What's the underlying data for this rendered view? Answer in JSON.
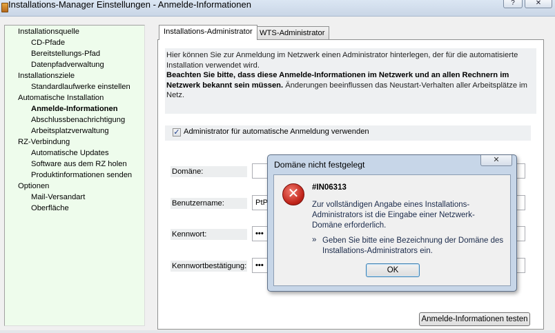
{
  "window": {
    "title": "Installations-Manager Einstellungen - Anmelde-Informationen",
    "help_label": "?",
    "close_label": "✕"
  },
  "tree": {
    "items": [
      {
        "label": "Installationsquelle",
        "level": 0
      },
      {
        "label": "CD-Pfade",
        "level": 1
      },
      {
        "label": "Bereitstellungs-Pfad",
        "level": 1
      },
      {
        "label": "Datenpfadverwaltung",
        "level": 1
      },
      {
        "label": "Installationsziele",
        "level": 0
      },
      {
        "label": "Standardlaufwerke einstellen",
        "level": 1
      },
      {
        "label": "Automatische Installation",
        "level": 0
      },
      {
        "label": "Anmelde-Informationen",
        "level": 1,
        "selected": true
      },
      {
        "label": "Abschlussbenachrichtigung",
        "level": 1
      },
      {
        "label": "Arbeitsplatzverwaltung",
        "level": 1
      },
      {
        "label": "RZ-Verbindung",
        "level": 0
      },
      {
        "label": "Automatische Updates",
        "level": 1
      },
      {
        "label": "Software aus dem RZ holen",
        "level": 1
      },
      {
        "label": "Produktinformationen senden",
        "level": 1
      },
      {
        "label": "Optionen",
        "level": 0
      },
      {
        "label": "Mail-Versandart",
        "level": 1
      },
      {
        "label": "Oberfläche",
        "level": 1
      }
    ]
  },
  "tabs": [
    {
      "label": "Installations-Administrator",
      "active": true
    },
    {
      "label": "WTS-Administrator",
      "active": false
    }
  ],
  "info": {
    "text1": "Hier können Sie zur Anmeldung im Netzwerk einen Administrator hinterlegen, der für die automatisierte Installation verwendet wird.",
    "bold": "Beachten Sie bitte, dass diese Anmelde-Informationen im Netzwerk und an allen Rechnern im Netzwerk bekannt sein müssen.",
    "text2": " Änderungen beeinflussen das Neustart-Verhalten aller Arbeitsplätze im Netz."
  },
  "checkbox": {
    "label": "Administrator für automatische Anmeldung verwenden",
    "checked": true,
    "mark": "✓"
  },
  "fields": {
    "domain_label": "Domäne:",
    "domain_value": "",
    "user_label": "Benutzername:",
    "user_value": "PtP",
    "password_label": "Kennwort:",
    "password_value": "•••",
    "confirm_label": "Kennwortbestätigung:",
    "confirm_value": "•••"
  },
  "test_button": "Anmelde-Informationen testen",
  "dialog": {
    "title": "Domäne nicht festgelegt",
    "close": "✕",
    "icon": "error-icon",
    "icon_glyph": "✕",
    "code": "#IN06313",
    "message": "Zur vollständigen Angabe eines Installations-Administrators ist die Eingabe einer Netzwerk-Domäne erforderlich.",
    "bullet": "»",
    "hint": "Geben Sie bitte eine Bezeichnung der Domäne des Installations-Administrators ein.",
    "ok": "OK"
  },
  "colors": {
    "tree_bg": "#eefcec",
    "error_red": "#c0241a",
    "dialog_frame": "#c7d6e8"
  }
}
